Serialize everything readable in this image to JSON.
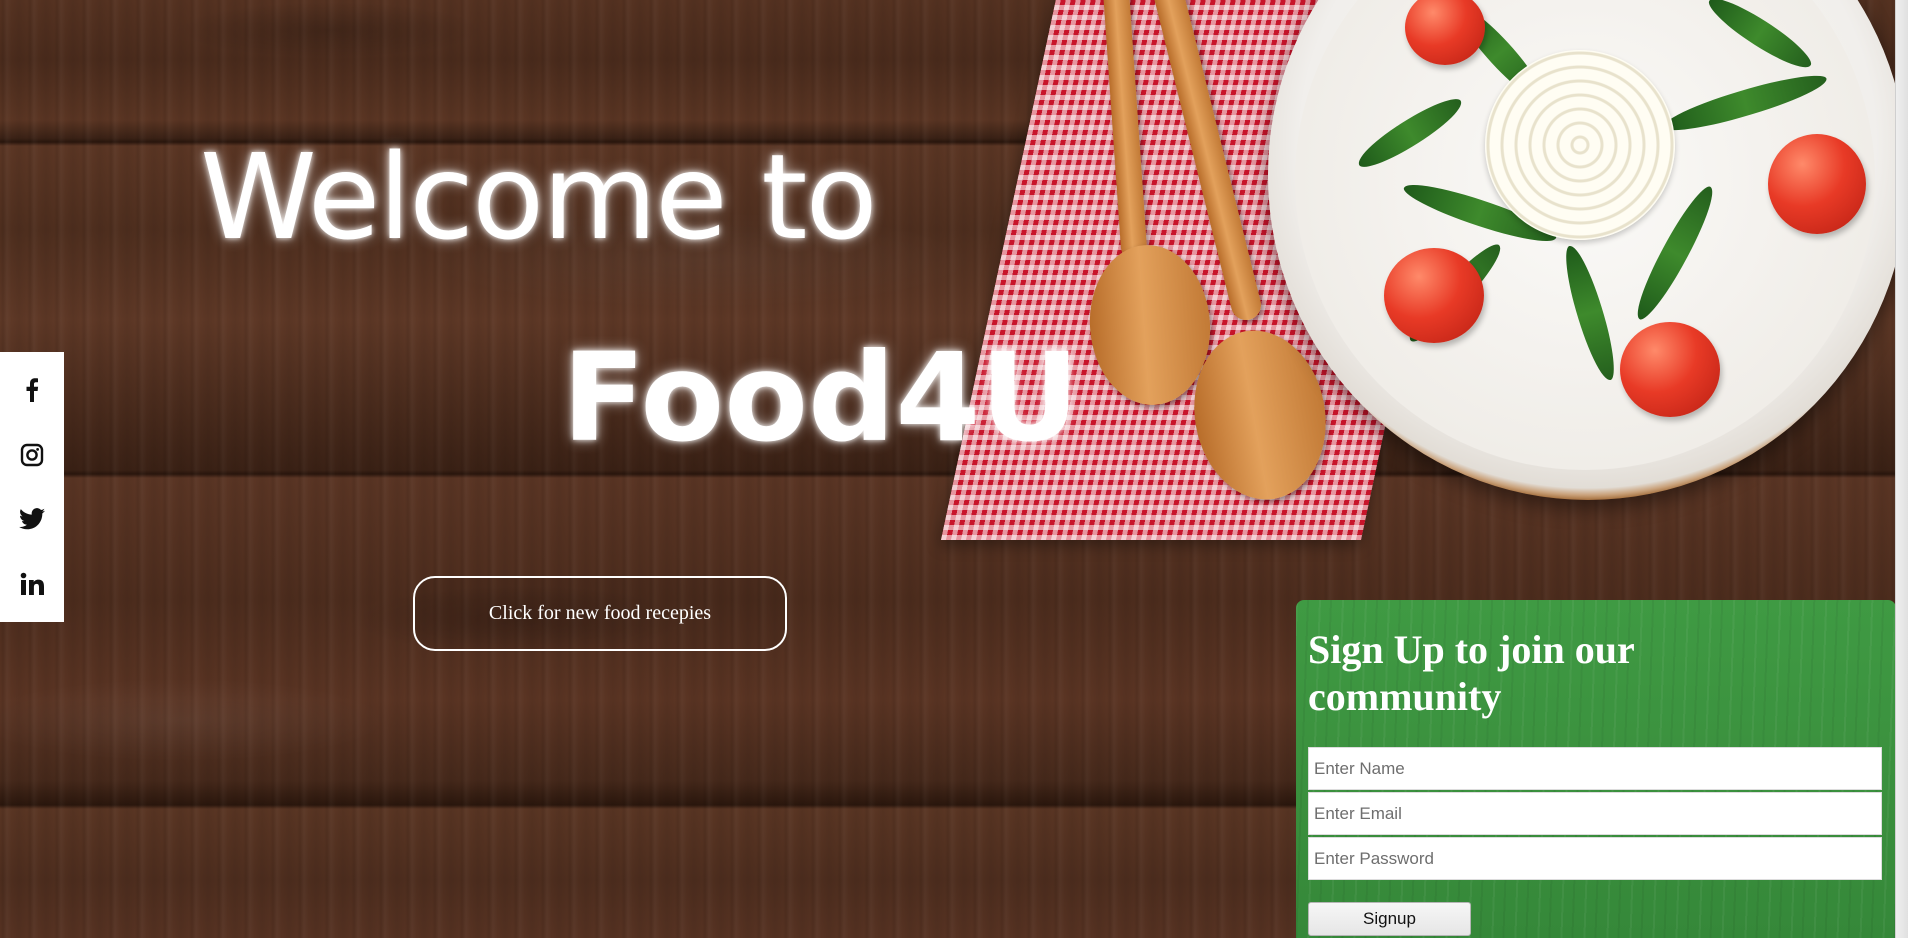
{
  "hero": {
    "welcome_text": "Welcome to",
    "brand_name": "Food4U",
    "cta_label": "Click for new food recepies"
  },
  "social": {
    "items": [
      {
        "name": "facebook",
        "icon": "facebook-icon"
      },
      {
        "name": "instagram",
        "icon": "instagram-icon"
      },
      {
        "name": "twitter",
        "icon": "twitter-icon"
      },
      {
        "name": "linkedin",
        "icon": "linkedin-icon"
      }
    ]
  },
  "signup": {
    "title": "Sign Up to join our community",
    "name_placeholder": "Enter Name",
    "email_placeholder": "Enter Email",
    "password_placeholder": "Enter Password",
    "button_label": "Signup"
  },
  "colors": {
    "signup_panel": "#3a8f3d",
    "cta_border": "#ffffff",
    "social_bar": "#ffffff"
  }
}
